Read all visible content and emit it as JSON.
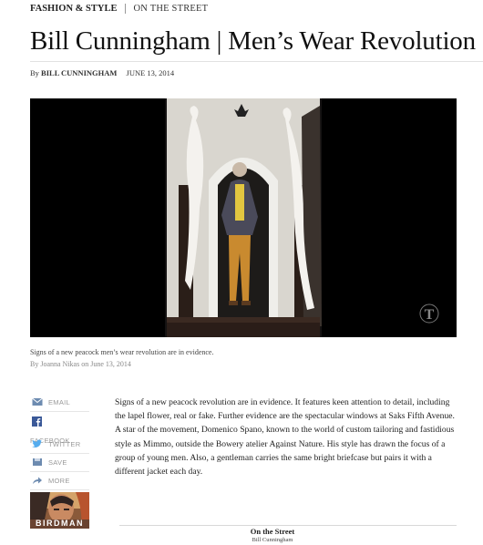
{
  "header": {
    "section": "FASHION & STYLE",
    "subsection": "ON THE STREET",
    "headline": "Bill Cunningham | Men’s Wear Revolution",
    "byline_prefix": "By",
    "author": "BILL CUNNINGHAM",
    "date": "JUNE 13, 2014"
  },
  "video": {
    "logo": "T",
    "caption": "Signs of a new peacock men’s wear revolution are in evidence.",
    "credit": "By Joanna Nikas on June 13, 2014"
  },
  "share": {
    "items": [
      {
        "label": "EMAIL",
        "icon": "envelope-icon"
      },
      {
        "label": "FACEBOOK",
        "icon": "facebook-icon"
      },
      {
        "label": "TWITTER",
        "icon": "twitter-icon"
      },
      {
        "label": "SAVE",
        "icon": "save-icon"
      },
      {
        "label": "MORE",
        "icon": "share-arrow-icon"
      }
    ]
  },
  "ad": {
    "title": "BIRDMAN"
  },
  "article": {
    "body": "Signs of a new peacock revolution are in evidence. It features keen attention to detail, including the lapel flower, real or fake. Further evidence are the spectacular windows at Saks Fifth Avenue. A star of the movement, Domenico Spano, known to the world of custom tailoring and fastidious style as Mimmo, outside the Bowery atelier Against Nature. His style has drawn the focus of a group of young men. Also, a gentleman carries the same bright briefcase but pairs it with a different jacket each day."
  },
  "footer": {
    "title": "On the Street",
    "author": "Bill Cunningham"
  }
}
